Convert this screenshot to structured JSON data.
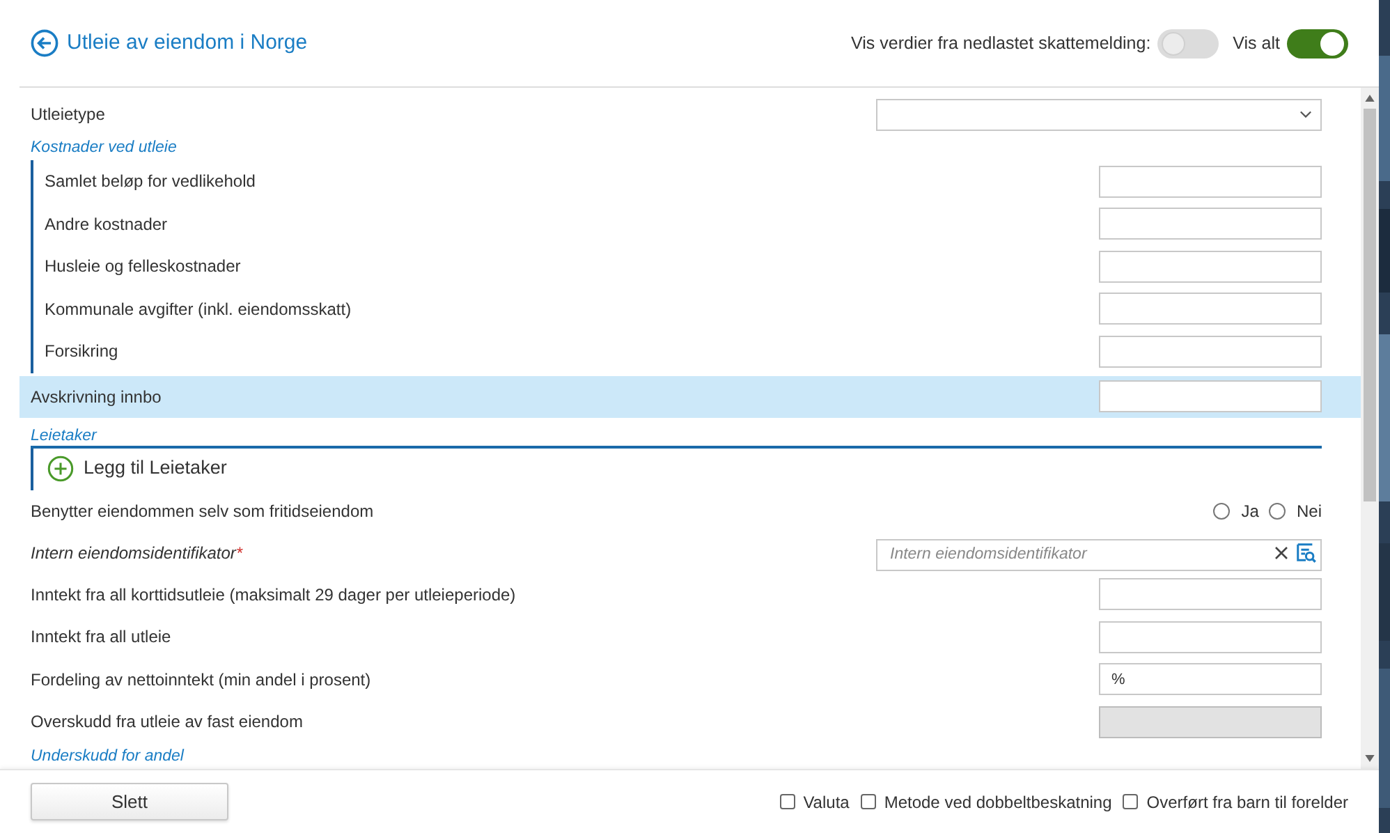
{
  "header": {
    "title": "Utleie av eiendom i Norge",
    "toggles": [
      {
        "label": "Vis verdier fra nedlastet skattemelding:",
        "on": false
      },
      {
        "label": "Vis alt",
        "on": true
      }
    ]
  },
  "form": [
    {
      "kind": "select",
      "label": "Utleietype"
    },
    {
      "kind": "group",
      "title": "Kostnader ved utleie",
      "children": [
        {
          "kind": "field",
          "label": "Samlet beløp for vedlikehold",
          "highlighted": false,
          "disabled": false
        },
        {
          "kind": "field",
          "label": "Andre kostnader",
          "highlighted": false,
          "disabled": false
        },
        {
          "kind": "field",
          "label": "Husleie og felleskostnader",
          "highlighted": false,
          "disabled": false
        },
        {
          "kind": "field",
          "label": "Kommunale avgifter (inkl. eiendomsskatt)",
          "highlighted": false,
          "disabled": false
        },
        {
          "kind": "field",
          "label": "Forsikring",
          "highlighted": false,
          "disabled": false
        }
      ]
    },
    {
      "kind": "field",
      "label": "Avskrivning innbo",
      "highlighted": true,
      "disabled": false
    },
    {
      "kind": "list",
      "title": "Leietaker",
      "add_label": "Legg til Leietaker"
    },
    {
      "kind": "radio",
      "label": "Benytter eiendommen selv som fritidseiendom",
      "options": [
        {
          "label": "Ja",
          "selected": false
        },
        {
          "label": "Nei",
          "selected": false
        }
      ]
    },
    {
      "kind": "search",
      "label": "Intern eiendomsidentifikator",
      "required_mark": "*",
      "placeholder": "Intern eiendomsidentifikator"
    },
    {
      "kind": "field",
      "label": "Inntekt fra all korttidsutleie (maksimalt 29 dager per utleieperiode)",
      "highlighted": false,
      "disabled": false
    },
    {
      "kind": "field",
      "label": "Inntekt fra all utleie",
      "highlighted": false,
      "disabled": false
    },
    {
      "kind": "field",
      "label": "Fordeling av nettoinntekt (min andel i prosent)",
      "value": "%",
      "highlighted": false,
      "disabled": false
    },
    {
      "kind": "field",
      "label": "Overskudd fra utleie av fast eiendom",
      "highlighted": false,
      "disabled": true
    },
    {
      "kind": "heading",
      "title": "Underskudd for andel"
    }
  ],
  "footer": {
    "button": "Slett",
    "checkboxes": [
      {
        "label": "Valuta",
        "checked": false
      },
      {
        "label": "Metode ved dobbeltbeskatning",
        "checked": false
      },
      {
        "label": "Overført fra barn til forelder",
        "checked": false
      }
    ]
  }
}
